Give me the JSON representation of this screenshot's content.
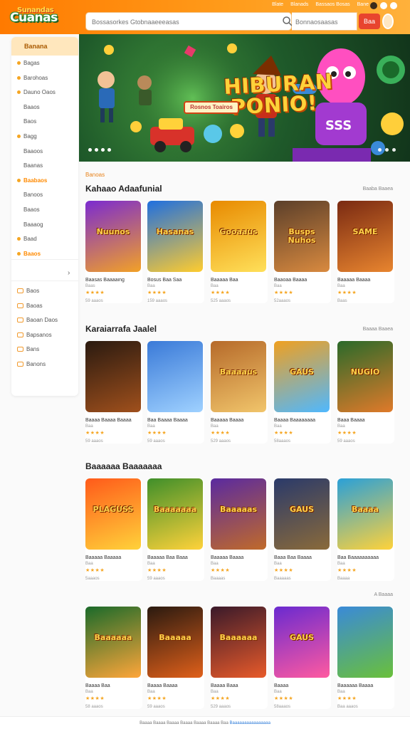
{
  "brand": {
    "logo_text": "Cuanas",
    "logo_top": "Sunandas",
    "accent": "#ff8a00",
    "cta_color": "#e8442e"
  },
  "header": {
    "top_links": [
      "Blate",
      "Blanads",
      "Bassaos Bosas",
      "Bane"
    ],
    "search_placeholder": "Bossasorkes Gtobnaaeeeasas",
    "filter_label": "Bonnaosaasas",
    "cta_label": "Baa"
  },
  "sidebar": {
    "header": "Banana",
    "items": [
      {
        "label": "Bagas",
        "dot": "#f5a623"
      },
      {
        "label": "Barohoas",
        "dot": "#f5a623"
      },
      {
        "label": "Dauno Oaos",
        "dot": "#f5a623"
      },
      {
        "label": "Baaos",
        "dot": ""
      },
      {
        "label": "Baos",
        "dot": ""
      },
      {
        "label": "Bagg",
        "dot": "#f5a623"
      },
      {
        "label": "Baaoos",
        "dot": ""
      },
      {
        "label": "Baanas",
        "dot": ""
      },
      {
        "label": "Baabaos",
        "dot": "#f5a623",
        "active": true
      },
      {
        "label": "Banoos",
        "dot": ""
      },
      {
        "label": "Baaos",
        "dot": ""
      },
      {
        "label": "Baaaog",
        "dot": ""
      },
      {
        "label": "Baad",
        "dot": "#f5a623"
      },
      {
        "label": "Baaos",
        "dot": "#f5a623",
        "active": true
      }
    ],
    "items2": [
      {
        "label": "Baos",
        "icon": "gamepad-icon"
      },
      {
        "label": "Baoas",
        "icon": "grid-icon"
      },
      {
        "label": "Baoan Daos",
        "icon": "calendar-icon"
      },
      {
        "label": "Bapsanos",
        "icon": "chart-icon"
      },
      {
        "label": "Bans",
        "icon": "mail-icon"
      },
      {
        "label": "Banons",
        "icon": "settings-icon"
      }
    ]
  },
  "hero": {
    "title_line1": "HIBURAN",
    "title_line2": "PONIO!",
    "sub_label": "Rosnos Toairos"
  },
  "breadcrumb": "Banoas",
  "sections": [
    {
      "title": "Kahaao Adaafunial",
      "see_all": "Baaba Baaea",
      "cards": [
        {
          "thumb_text": "Nuunos",
          "title": "Baasas Baaaaing",
          "genre": "Baas",
          "stars": "★★★★",
          "plays": "59 aaaos",
          "c1": "#7b2bd0",
          "c2": "#f2a127"
        },
        {
          "thumb_text": "Hasanas",
          "title": "Bosus Baa Saa",
          "genre": "Baa",
          "stars": "★★★★",
          "plays": "159 aaaos",
          "c1": "#1f6fe0",
          "c2": "#ffcc2e"
        },
        {
          "thumb_text": "Gooaaus",
          "title": "Baaaaa Baa",
          "genre": "Baa",
          "stars": "★★★★",
          "plays": "525 aaaos",
          "c1": "#e88a00",
          "c2": "#ffe05a"
        },
        {
          "thumb_text": "Busps Nuhos",
          "title": "Baaoaa Baaaa",
          "genre": "Baa",
          "stars": "★★★★",
          "plays": "52aaaos",
          "c1": "#5b3f2a",
          "c2": "#d98a3f"
        },
        {
          "thumb_text": "SAME",
          "title": "Baaaaa Baaaa",
          "genre": "Baa",
          "stars": "★★★★",
          "plays": "Baas",
          "c1": "#7a2a12",
          "c2": "#e8852f"
        }
      ]
    },
    {
      "title": "Karaiarrafa Jaalel",
      "see_all": "Baaaa Baaea",
      "cards": [
        {
          "thumb_text": "",
          "title": "Baaaa Baaaa Baaaa",
          "genre": "Baa",
          "stars": "★★★★",
          "plays": "59 aaaos",
          "c1": "#2a1a10",
          "c2": "#a0501c"
        },
        {
          "thumb_text": "",
          "title": "Baa Baaaa Baaaa",
          "genre": "Baa",
          "stars": "★★★★",
          "plays": "59 aaaos",
          "c1": "#3a7ad8",
          "c2": "#9fd1ff"
        },
        {
          "thumb_text": "Baaaaus",
          "title": "Baaaaa Baaaa",
          "genre": "Baa",
          "stars": "★★★★",
          "plays": "529 aaaos",
          "c1": "#b66a2a",
          "c2": "#f1c56b"
        },
        {
          "thumb_text": "GAUS",
          "title": "Baaaa Baaaaaaaa",
          "genre": "Baa",
          "stars": "★★★★",
          "plays": "58aaaos",
          "c1": "#f0a020",
          "c2": "#4fb8ff"
        },
        {
          "thumb_text": "NUGIO",
          "title": "Baaa Baaaa",
          "genre": "Baa",
          "stars": "★★★★",
          "plays": "59 aaaos",
          "c1": "#2a6a2a",
          "c2": "#e07a2a"
        }
      ]
    },
    {
      "title": "Baaaaaa Baaaaaaa",
      "see_all": "",
      "cards": [
        {
          "thumb_text": "PLAGUSS",
          "title": "Baaaaa Baaaaa",
          "genre": "Baa",
          "stars": "★★★★",
          "plays": "5aaaos",
          "c1": "#ff5a1a",
          "c2": "#ffd23a"
        },
        {
          "thumb_text": "Baaaaaaa",
          "title": "Baaaaa Baa Baaa",
          "genre": "Baa",
          "stars": "★★★★",
          "plays": "59 aaaos",
          "c1": "#3f8f2a",
          "c2": "#ffd23a"
        },
        {
          "thumb_text": "Baaaaas",
          "title": "Baaaaa Baaaa",
          "genre": "Baa",
          "stars": "★★★★",
          "plays": "Baaaas",
          "c1": "#5a2aa0",
          "c2": "#c06a2a"
        },
        {
          "thumb_text": "GAUS",
          "title": "Baaa Baa Baaaa",
          "genre": "Baa",
          "stars": "★★★★",
          "plays": "Baaaaas",
          "c1": "#2a3a6a",
          "c2": "#8a6a3a"
        },
        {
          "thumb_text": "Baaaa",
          "title": "Baa Baaaaaaaaaa",
          "genre": "Baa",
          "stars": "★★★★",
          "plays": "Baaaa",
          "c1": "#2aa0d8",
          "c2": "#ffd23a"
        }
      ]
    },
    {
      "title": "",
      "see_all": "A Baaaa",
      "cards": [
        {
          "thumb_text": "Baaaaaa",
          "title": "Baaaa Baa",
          "genre": "Baa",
          "stars": "★★★★",
          "plays": "58 aaaos",
          "c1": "#1a6a2a",
          "c2": "#ffa63a"
        },
        {
          "thumb_text": "Baaaaa",
          "title": "Baaaa Baaaa",
          "genre": "Baa",
          "stars": "★★★★",
          "plays": "59 aaaos",
          "c1": "#2a1a10",
          "c2": "#e0601a"
        },
        {
          "thumb_text": "Baaaaaa",
          "title": "Baaaa Baaa",
          "genre": "Baa",
          "stars": "★★★★",
          "plays": "529 aaaos",
          "c1": "#3a1a2a",
          "c2": "#e85a2a"
        },
        {
          "thumb_text": "GAUS",
          "title": "Baaaa",
          "genre": "Baa",
          "stars": "★★★★",
          "plays": "58aaaos",
          "c1": "#6a2ad0",
          "c2": "#ff5aa0"
        },
        {
          "thumb_text": "",
          "title": "Baaaaaa Baaaa",
          "genre": "Baa",
          "stars": "★★★★",
          "plays": "Baa aaaos",
          "c1": "#3a8ad8",
          "c2": "#6ac03a"
        }
      ]
    }
  ],
  "footer": {
    "text": "Baaaa Baaaa Baaaa Baaaa Baaaa Baaaa Baa",
    "link": "Baaaaaaaaaaaaaaaa"
  }
}
